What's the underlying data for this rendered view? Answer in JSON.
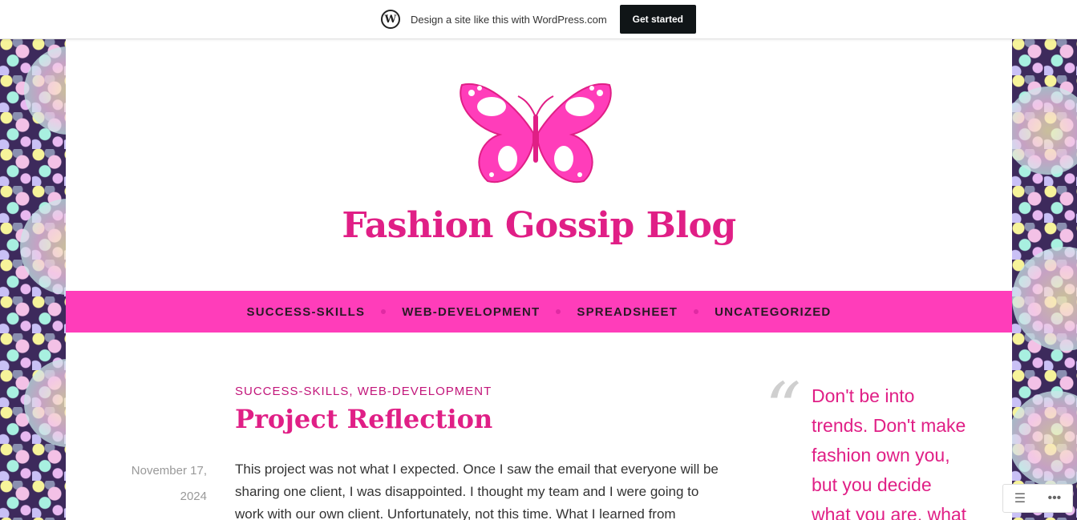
{
  "wpbar": {
    "text": "Design a site like this with WordPress.com",
    "button": "Get started",
    "logo_glyph": "W"
  },
  "site": {
    "title": "Fashion Gossip Blog",
    "logo": "butterfly-logo",
    "accent_color": "#e01f86",
    "nav_color": "#ff3dba"
  },
  "nav": {
    "items": [
      {
        "label": "SUCCESS-SKILLS"
      },
      {
        "label": "WEB-DEVELOPMENT"
      },
      {
        "label": "SPREADSHEET"
      },
      {
        "label": "UNCATEGORIZED"
      }
    ]
  },
  "post": {
    "categories": [
      "SUCCESS-SKILLS",
      "WEB-DEVELOPMENT"
    ],
    "category_separator": ",",
    "title": "Project Reflection",
    "date_line1": "November 17,",
    "date_line2": "2024",
    "excerpt": "This project was not what I expected. Once I saw the email that everyone will be sharing one client, I was disappointed. I thought my team and I were going to work with our own client. Unfortunately, not this time. What I learned from"
  },
  "sidebar": {
    "quote_mark": "“",
    "quote": "Don't be into trends. Don't make fashion own you, but you decide what you are, what"
  },
  "widget": {
    "icon": "reader-icon",
    "more": "more-icon"
  }
}
